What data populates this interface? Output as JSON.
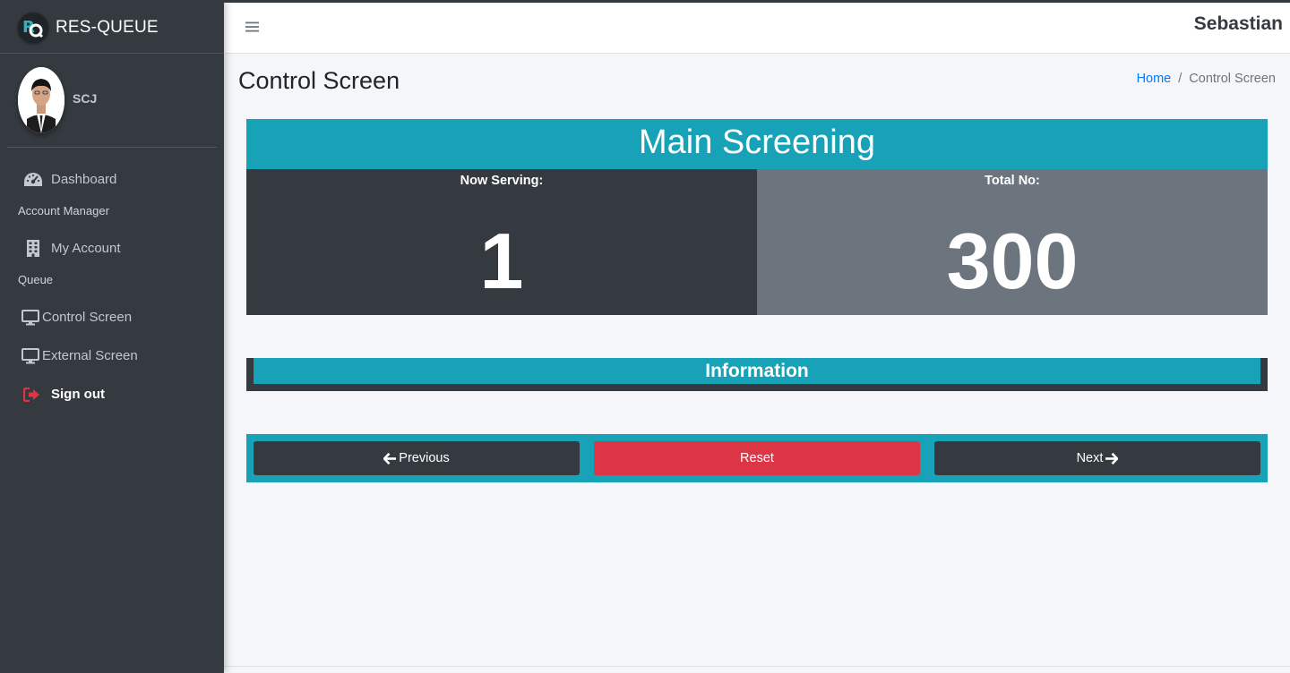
{
  "app": {
    "brand": "RES-QUEUE",
    "current_user": "Sebastian"
  },
  "sidebar": {
    "user": {
      "name": "SCJ"
    },
    "items": [
      {
        "type": "link",
        "label": "Dashboard",
        "icon": "tachometer-icon"
      },
      {
        "type": "header",
        "label": "Account Manager"
      },
      {
        "type": "link",
        "label": "My Account",
        "icon": "building-icon"
      },
      {
        "type": "header",
        "label": "Queue"
      },
      {
        "type": "link",
        "label": "Control Screen",
        "icon": "desktop-icon"
      },
      {
        "type": "link",
        "label": "External Screen",
        "icon": "desktop-icon"
      },
      {
        "type": "link",
        "label": "Sign out",
        "icon": "sign-out-icon"
      }
    ]
  },
  "header": {
    "title": "Control Screen",
    "breadcrumb": {
      "home": "Home",
      "current": "Control Screen"
    }
  },
  "queue": {
    "screen_name": "Main Screening",
    "now_serving_label": "Now Serving:",
    "now_serving": "1",
    "total_label": "Total No:",
    "total": "300"
  },
  "info": {
    "title": "Information"
  },
  "controls": {
    "previous": "Previous",
    "reset": "Reset",
    "next": "Next"
  },
  "colors": {
    "sidebar_bg": "#343a40",
    "info_teal": "#17a2b8",
    "muted_gray": "#6c757d",
    "danger_red": "#dc3545",
    "link_blue": "#007bff",
    "signout_icon_red": "#dc3545"
  }
}
